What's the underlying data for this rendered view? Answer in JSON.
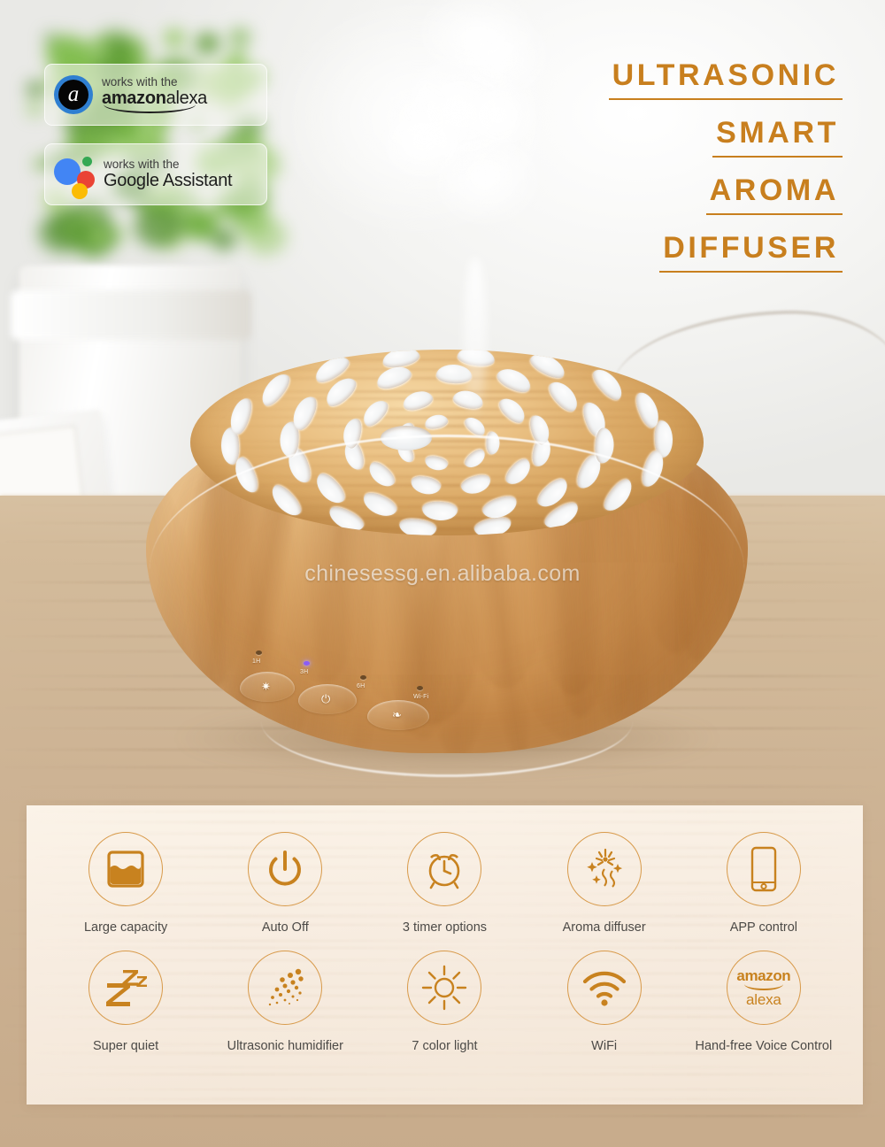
{
  "brand": {
    "accent_orange": "#C87F1E",
    "icon_orange": "#C8821F",
    "circle_outline": "#D89A4A",
    "label_gray": "#4C4A47",
    "alexa_blue": "#2F7FD1",
    "google_blue": "#4285F4",
    "google_red": "#EA4335",
    "google_yellow": "#FBBC05",
    "google_green": "#34A853",
    "led_active": "#8B5CF6"
  },
  "badges": [
    {
      "id": "alexa-badge",
      "icon": "amazon-alexa-icon",
      "top_line": "works with the",
      "bottom_bold": "amazon",
      "bottom_thin": "alexa"
    },
    {
      "id": "google-assistant-badge",
      "icon": "google-assistant-icon",
      "top_line": "works with the",
      "bottom_bold": "Google",
      "bottom_thin": "Assistant"
    }
  ],
  "headline": {
    "lines": [
      "ULTRASONIC",
      "SMART",
      "AROMA",
      "DIFFUSER"
    ]
  },
  "watermark": "chinesessg.en.alibaba.com",
  "product": {
    "controls": {
      "led_labels": [
        "1H",
        "3H",
        "6H",
        "Wi-Fi"
      ],
      "led_states": [
        "off",
        "on",
        "off",
        "off"
      ],
      "buttons": [
        {
          "name": "light-button",
          "glyph": "✷"
        },
        {
          "name": "power-button",
          "glyph": "⏻"
        },
        {
          "name": "mist-button",
          "glyph": "❧"
        }
      ]
    }
  },
  "features": {
    "row1": [
      {
        "icon": "water-tank-icon",
        "label": "Large capacity"
      },
      {
        "icon": "power-icon",
        "label": "Auto Off"
      },
      {
        "icon": "alarm-clock-icon",
        "label": "3 timer options"
      },
      {
        "icon": "aroma-sparkle-icon",
        "label": "Aroma diffuser"
      },
      {
        "icon": "smartphone-icon",
        "label": "APP control"
      }
    ],
    "row2": [
      {
        "icon": "sleep-zzz-icon",
        "label": "Super quiet"
      },
      {
        "icon": "mist-dots-icon",
        "label": "Ultrasonic humidifier"
      },
      {
        "icon": "sun-icon",
        "label": "7 color light"
      },
      {
        "icon": "wifi-icon",
        "label": "WiFi"
      },
      {
        "icon": "amazon-alexa-wordmark-icon",
        "label": "Hand-free Voice Control"
      }
    ]
  },
  "alexa_wordmark": {
    "top": "amazon",
    "bottom": "alexa"
  }
}
